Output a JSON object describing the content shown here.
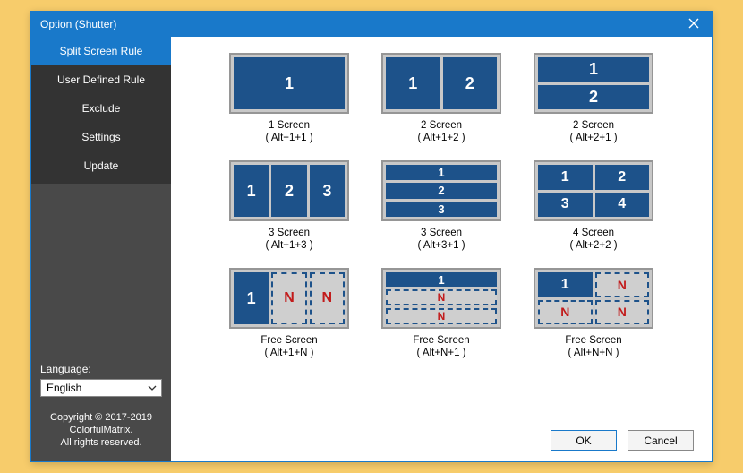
{
  "window": {
    "title": "Option (Shutter)"
  },
  "sidebar": {
    "items": [
      {
        "label": "Split Screen Rule",
        "active": true
      },
      {
        "label": "User Defined Rule",
        "active": false
      },
      {
        "label": "Exclude",
        "active": false
      },
      {
        "label": "Settings",
        "active": false
      },
      {
        "label": "Update",
        "active": false
      }
    ],
    "language_label": "Language:",
    "language_value": "English",
    "copyright_lines": [
      "Copyright © 2017-2019",
      "ColorfulMatrix.",
      "All rights reserved."
    ]
  },
  "rules": [
    {
      "title": "1 Screen",
      "shortcut": "( Alt+1+1 )",
      "layout": "1"
    },
    {
      "title": "2 Screen",
      "shortcut": "( Alt+1+2 )",
      "layout": "1x2"
    },
    {
      "title": "2 Screen",
      "shortcut": "( Alt+2+1 )",
      "layout": "2x1"
    },
    {
      "title": "3 Screen",
      "shortcut": "( Alt+1+3 )",
      "layout": "1x3"
    },
    {
      "title": "3 Screen",
      "shortcut": "( Alt+3+1 )",
      "layout": "3x1"
    },
    {
      "title": "4 Screen",
      "shortcut": "( Alt+2+2 )",
      "layout": "2x2"
    },
    {
      "title": "Free Screen",
      "shortcut": "( Alt+1+N )",
      "layout": "free-1n"
    },
    {
      "title": "Free Screen",
      "shortcut": "( Alt+N+1 )",
      "layout": "free-n1"
    },
    {
      "title": "Free Screen",
      "shortcut": "( Alt+N+N )",
      "layout": "free-nn"
    }
  ],
  "buttons": {
    "ok": "OK",
    "cancel": "Cancel"
  },
  "labels": {
    "n": "N"
  }
}
